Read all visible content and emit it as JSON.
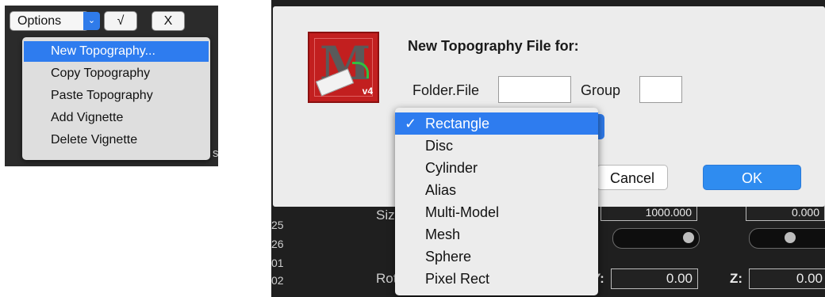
{
  "left_menu_panel": {
    "toolbar": {
      "options_label": "Options",
      "check_label": "√",
      "close_label": "X"
    },
    "menu_items": [
      {
        "label": "New Topography...",
        "selected": true
      },
      {
        "label": "Copy Topography",
        "selected": false
      },
      {
        "label": "Paste Topography",
        "selected": false
      },
      {
        "label": "Add Vignette",
        "selected": false
      },
      {
        "label": "Delete Vignette",
        "selected": false
      }
    ],
    "edge_text": "s"
  },
  "dialog": {
    "title": "New Topography File for:",
    "folder_file_label": "Folder.File",
    "folder_file_value": "",
    "group_label": "Group",
    "group_value": "",
    "cancel_label": "Cancel",
    "ok_label": "OK",
    "icon_letter": "M",
    "icon_badge": "v4",
    "shape_dropdown": {
      "selected": "Rectangle",
      "check_mark": "✓",
      "options": [
        "Rectangle",
        "Disc",
        "Cylinder",
        "Alias",
        "Multi-Model",
        "Mesh",
        "Sphere",
        "Pixel Rect"
      ]
    }
  },
  "background_app": {
    "left_numbers": [
      "25",
      "26",
      "01",
      "02"
    ],
    "size_label": "Siz",
    "size_value": "1000.000",
    "rot_label": "Rot",
    "y_label": "Y:",
    "y_value": "0.00",
    "z_label": "Z:",
    "z_value": "0.00",
    "top_y_value": "0.000"
  },
  "colors": {
    "accent_blue": "#2e7cef",
    "ok_blue": "#2f8cf0",
    "icon_red": "#c21f1f"
  }
}
